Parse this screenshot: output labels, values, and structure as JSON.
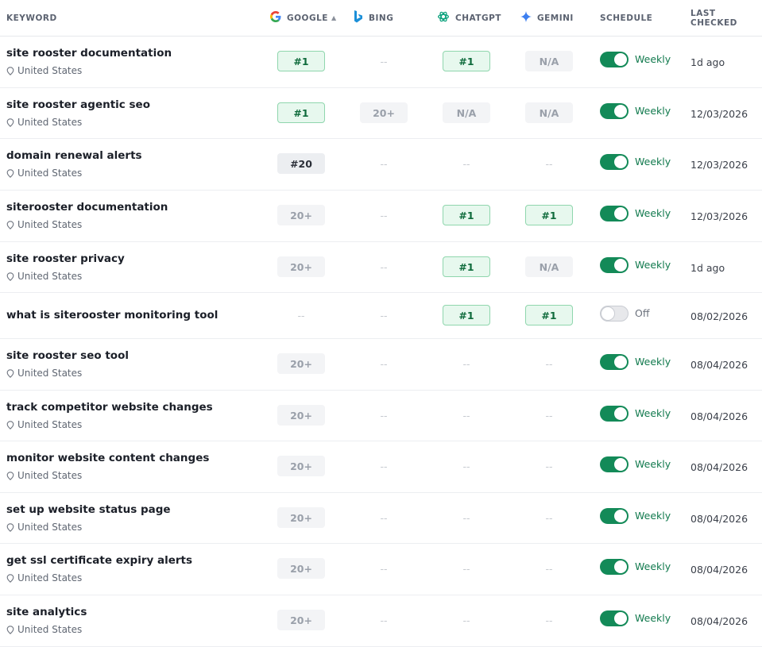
{
  "headers": {
    "keyword": "KEYWORD",
    "google": "GOOGLE",
    "google_sort": "▲",
    "bing": "BING",
    "chatgpt": "CHATGPT",
    "gemini": "GEMINI",
    "schedule": "SCHEDULE",
    "last_checked": "LAST CHECKED"
  },
  "colors": {
    "accent_green": "#138a58",
    "first_badge_bg": "#e7f8ee",
    "first_badge_border": "#8fd6ad"
  },
  "rows": [
    {
      "keyword": "site rooster documentation",
      "location": "United States",
      "google": "#1",
      "bing": "--",
      "chatgpt": "#1",
      "gemini": "N/A",
      "schedule_on": true,
      "schedule": "Weekly",
      "last_checked": "1d ago"
    },
    {
      "keyword": "site rooster agentic seo",
      "location": "United States",
      "google": "#1",
      "bing": "20+",
      "chatgpt": "N/A",
      "gemini": "N/A",
      "schedule_on": true,
      "schedule": "Weekly",
      "last_checked": "12/03/2026"
    },
    {
      "keyword": "domain renewal alerts",
      "location": "United States",
      "google": "#20",
      "bing": "--",
      "chatgpt": "--",
      "gemini": "--",
      "schedule_on": true,
      "schedule": "Weekly",
      "last_checked": "12/03/2026"
    },
    {
      "keyword": "siterooster documentation",
      "location": "United States",
      "google": "20+",
      "bing": "--",
      "chatgpt": "#1",
      "gemini": "#1",
      "schedule_on": true,
      "schedule": "Weekly",
      "last_checked": "12/03/2026"
    },
    {
      "keyword": "site rooster privacy",
      "location": "United States",
      "google": "20+",
      "bing": "--",
      "chatgpt": "#1",
      "gemini": "N/A",
      "schedule_on": true,
      "schedule": "Weekly",
      "last_checked": "1d ago"
    },
    {
      "keyword": "what is siterooster monitoring tool",
      "location": "",
      "google": "--",
      "bing": "--",
      "chatgpt": "#1",
      "gemini": "#1",
      "schedule_on": false,
      "schedule": "Off",
      "last_checked": "08/02/2026"
    },
    {
      "keyword": "site rooster seo tool",
      "location": "United States",
      "google": "20+",
      "bing": "--",
      "chatgpt": "--",
      "gemini": "--",
      "schedule_on": true,
      "schedule": "Weekly",
      "last_checked": "08/04/2026"
    },
    {
      "keyword": "track competitor website changes",
      "location": "United States",
      "google": "20+",
      "bing": "--",
      "chatgpt": "--",
      "gemini": "--",
      "schedule_on": true,
      "schedule": "Weekly",
      "last_checked": "08/04/2026"
    },
    {
      "keyword": "monitor website content changes",
      "location": "United States",
      "google": "20+",
      "bing": "--",
      "chatgpt": "--",
      "gemini": "--",
      "schedule_on": true,
      "schedule": "Weekly",
      "last_checked": "08/04/2026"
    },
    {
      "keyword": "set up website status page",
      "location": "United States",
      "google": "20+",
      "bing": "--",
      "chatgpt": "--",
      "gemini": "--",
      "schedule_on": true,
      "schedule": "Weekly",
      "last_checked": "08/04/2026"
    },
    {
      "keyword": "get ssl certificate expiry alerts",
      "location": "United States",
      "google": "20+",
      "bing": "--",
      "chatgpt": "--",
      "gemini": "--",
      "schedule_on": true,
      "schedule": "Weekly",
      "last_checked": "08/04/2026"
    },
    {
      "keyword": "site analytics",
      "location": "United States",
      "google": "20+",
      "bing": "--",
      "chatgpt": "--",
      "gemini": "--",
      "schedule_on": true,
      "schedule": "Weekly",
      "last_checked": "08/04/2026"
    }
  ]
}
